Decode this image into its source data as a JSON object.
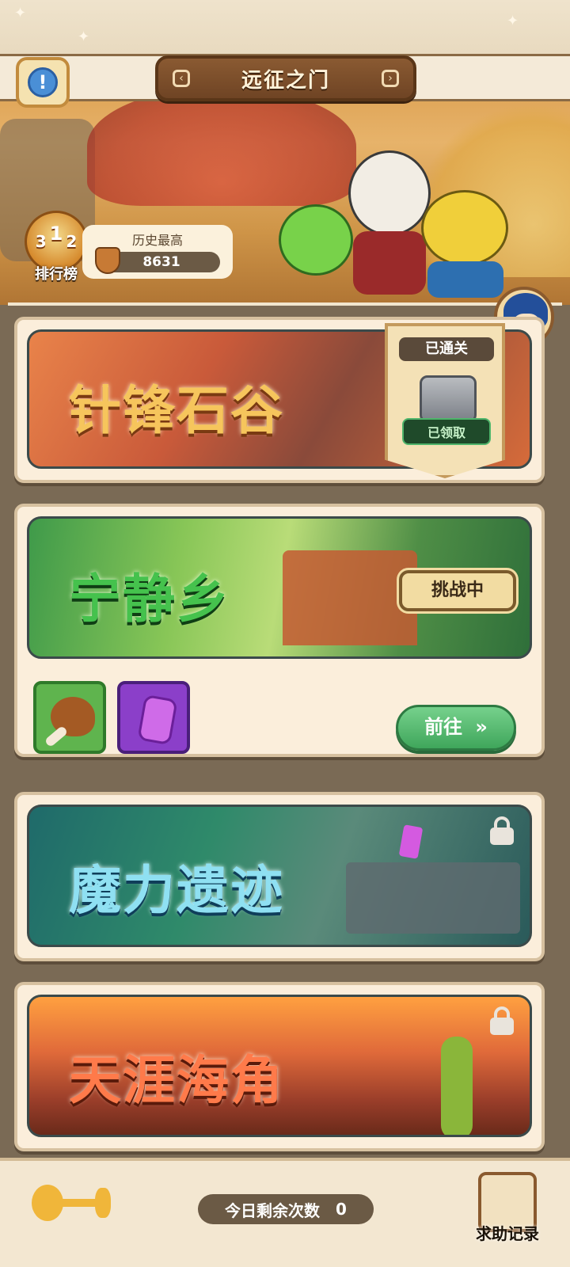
{
  "header": {
    "title": "远征之门",
    "info_icon": "info-icon",
    "chevron_left_icon": "chevron-left-icon",
    "chevron_right_icon": "chevron-right-icon"
  },
  "ranking": {
    "label": "排行榜",
    "icon": "trophy-icon",
    "badge_digits": [
      "3",
      "1",
      "2"
    ]
  },
  "best_score": {
    "caption": "历史最高",
    "value": "8631",
    "icon": "shield-icon"
  },
  "levels": [
    {
      "name": "针锋石谷",
      "status": "已通关",
      "reward_status": "已领取",
      "name_color": "#f6c55c"
    },
    {
      "name": "宁静乡",
      "status": "挑战中",
      "name_color": "#45c24d",
      "rewards": [
        {
          "icon": "drumstick-icon"
        },
        {
          "icon": "purple-gem-icon"
        }
      ],
      "go_label": "前往",
      "go_arrow": "»"
    },
    {
      "name": "魔力遗迹",
      "locked": true,
      "lock_icon": "lock-icon",
      "name_color": "#8fe0f2"
    },
    {
      "name": "天涯海角",
      "locked": true,
      "lock_icon": "lock-icon",
      "name_color": "#ff7a4a"
    }
  ],
  "footer": {
    "remaining_label": "今日剩余次数",
    "remaining_value": "0",
    "help_label": "求助记录",
    "help_icon": "scroll-icon",
    "fish_icon": "fishbone-icon"
  }
}
